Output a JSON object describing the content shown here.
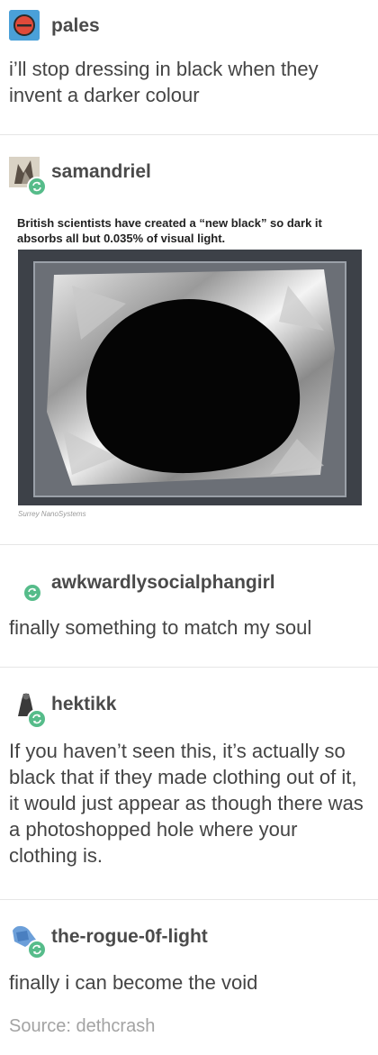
{
  "posts": [
    {
      "username": "pales",
      "text": "i’ll stop dressing in black when they invent a darker colour"
    },
    {
      "username": "samandriel",
      "caption": "British scientists have created a “new black” so dark it absorbs all but 0.035% of visual light.",
      "image_credit": "Surrey NanoSystems"
    },
    {
      "username": "awkwardlysocialphangirl",
      "text": "finally something to match my soul"
    },
    {
      "username": "hektikk",
      "text": "If you haven’t seen this, it’s actually so black that if they made clothing out of it, it would just appear as though there was a photoshopped hole where your clothing is."
    },
    {
      "username": "the-rogue-0f-light",
      "text": "finally i can become the void"
    }
  ],
  "source": "Source: dethcrash",
  "colors": {
    "reblog_badge": "#56bc8a",
    "divider": "#e6e6e6",
    "username": "#4a4a4a",
    "text": "#444444",
    "source": "#a3a3a3"
  },
  "icons": [
    "reblog-icon"
  ]
}
